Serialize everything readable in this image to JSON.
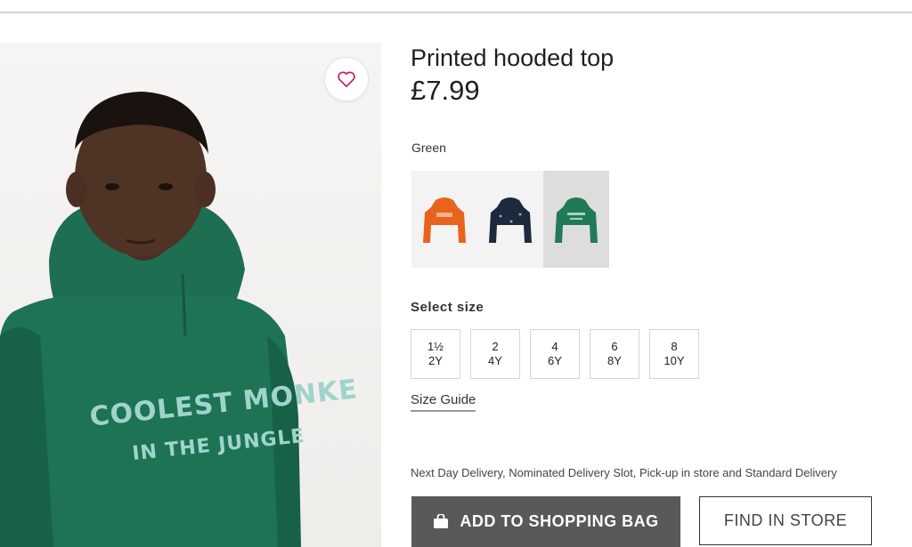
{
  "product": {
    "title": "Printed hooded top",
    "price": "£7.99",
    "image_print": {
      "line1": "COOLEST MONKE",
      "line2": "IN THE JUNGLE"
    }
  },
  "color": {
    "label": "Green",
    "swatches": [
      {
        "name": "orange",
        "hex": "#e8641e",
        "selected": false
      },
      {
        "name": "dark-blue",
        "hex": "#1d2a3d",
        "selected": false
      },
      {
        "name": "green",
        "hex": "#1f7a55",
        "selected": true
      }
    ]
  },
  "size": {
    "label": "Select size",
    "options": [
      {
        "top": "1½",
        "bottom": "2Y"
      },
      {
        "top": "2",
        "bottom": "4Y"
      },
      {
        "top": "4",
        "bottom": "6Y"
      },
      {
        "top": "6",
        "bottom": "8Y"
      },
      {
        "top": "8",
        "bottom": "10Y"
      }
    ],
    "guide": "Size Guide"
  },
  "delivery_text": "Next Day Delivery, Nominated Delivery Slot, Pick-up in store and Standard Delivery",
  "actions": {
    "add_to_bag": "ADD TO SHOPPING BAG",
    "find_in_store": "FIND IN STORE"
  },
  "icons": {
    "favorite": "heart-icon",
    "bag": "shopping-bag-icon"
  }
}
